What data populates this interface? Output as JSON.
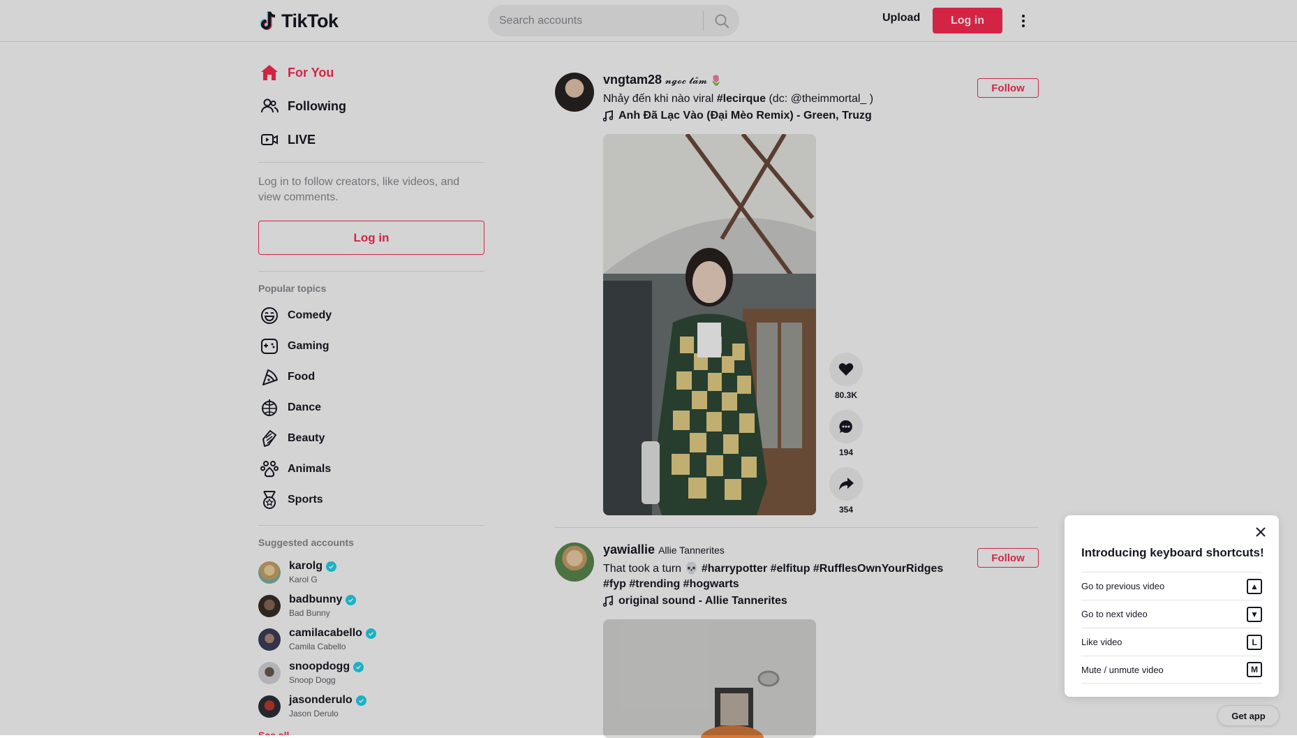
{
  "header": {
    "logo_text": "TikTok",
    "search_placeholder": "Search accounts",
    "upload_label": "Upload",
    "login_label": "Log in"
  },
  "sidebar": {
    "nav": [
      {
        "label": "For You",
        "icon": "home-icon",
        "active": true
      },
      {
        "label": "Following",
        "icon": "users-icon",
        "active": false
      },
      {
        "label": "LIVE",
        "icon": "live-icon",
        "active": false
      }
    ],
    "login_hint": "Log in to follow creators, like videos, and view comments.",
    "login_label": "Log in",
    "popular_title": "Popular topics",
    "topics": [
      {
        "label": "Comedy",
        "icon": "comedy-icon"
      },
      {
        "label": "Gaming",
        "icon": "gaming-icon"
      },
      {
        "label": "Food",
        "icon": "food-icon"
      },
      {
        "label": "Dance",
        "icon": "dance-icon"
      },
      {
        "label": "Beauty",
        "icon": "beauty-icon"
      },
      {
        "label": "Animals",
        "icon": "animals-icon"
      },
      {
        "label": "Sports",
        "icon": "sports-icon"
      }
    ],
    "suggested_title": "Suggested accounts",
    "accounts": [
      {
        "handle": "karolg",
        "name": "Karol G"
      },
      {
        "handle": "badbunny",
        "name": "Bad Bunny"
      },
      {
        "handle": "camilacabello",
        "name": "Camila Cabello"
      },
      {
        "handle": "snoopdogg",
        "name": "Snoop Dogg"
      },
      {
        "handle": "jasonderulo",
        "name": "Jason Derulo"
      }
    ],
    "see_all": "See all"
  },
  "posts": [
    {
      "username": "vngtam28",
      "nickname": "𝓷𝓰𝓸𝓬 𝓽𝓪̂𝓶 🌷",
      "caption_text": "Nhảy đến khi nào viral ",
      "caption_tag": "#lecirque",
      "caption_tail": " (dc: ",
      "caption_mention": "@theimmortal_",
      "caption_end": " )",
      "music": "Anh Đã Lạc Vào (Đại Mèo Remix) - Green, Truzg",
      "follow_label": "Follow",
      "likes": "80.3K",
      "comments": "194",
      "shares": "354"
    },
    {
      "username": "yawiallie",
      "nickname": "Allie Tannerites",
      "caption_text": "That took a turn 💀 ",
      "caption_tags": "#harrypotter #elfitup #RufflesOwnYourRidges #fyp #trending #hogwarts",
      "music": "original sound - Allie Tannerites",
      "follow_label": "Follow"
    }
  ],
  "shortcuts": {
    "title": "Introducing keyboard shortcuts!",
    "rows": [
      {
        "label": "Go to previous video",
        "key": "▲"
      },
      {
        "label": "Go to next video",
        "key": "▼"
      },
      {
        "label": "Like video",
        "key": "L"
      },
      {
        "label": "Mute / unmute video",
        "key": "M"
      }
    ]
  },
  "get_app": "Get app",
  "colors": {
    "accent": "#fe2c55",
    "text": "#161823",
    "muted": "#8a8b91",
    "verified": "#20d5ec"
  }
}
